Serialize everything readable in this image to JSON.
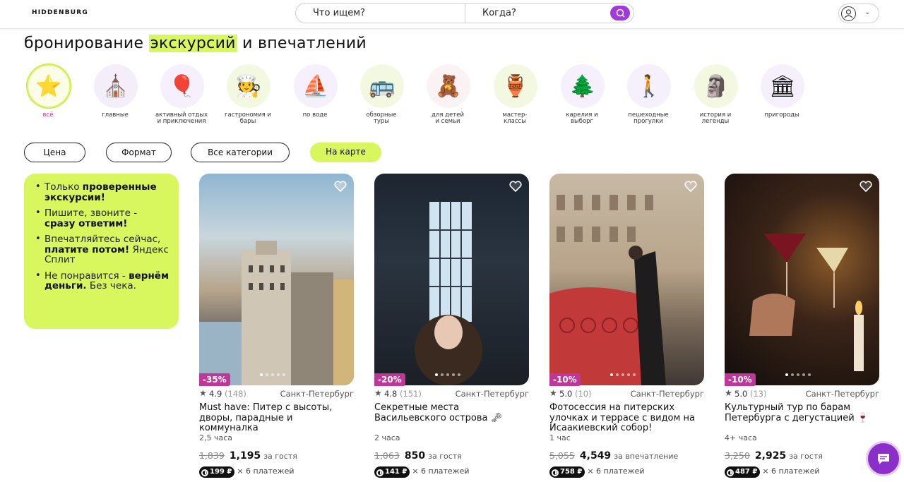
{
  "header": {
    "logo": "HIDDENBURG",
    "search": {
      "what": "Что ищем?",
      "when": "Когда?"
    }
  },
  "title": {
    "prefix": "бронирование ",
    "highlight": "экскурсий",
    "suffix": " и впечатлений"
  },
  "categories": [
    {
      "label": "всё",
      "icon": "star-icon",
      "emoji": "⭐",
      "active": true
    },
    {
      "label": "главные",
      "icon": "cathedral-icon",
      "emoji": "⛪"
    },
    {
      "label": "активный отдых и приключения",
      "icon": "balloon-icon",
      "emoji": "🎈"
    },
    {
      "label": "гастрономия и бары",
      "icon": "chef-icon",
      "emoji": "🧑‍🍳"
    },
    {
      "label": "по воде",
      "icon": "boat-icon",
      "emoji": "⛵"
    },
    {
      "label": "обзорные туры",
      "icon": "bus-icon",
      "emoji": "🚌"
    },
    {
      "label": "для детей и семьи",
      "icon": "teddy-bear-icon",
      "emoji": "🧸"
    },
    {
      "label": "мастер-классы",
      "icon": "potter-icon",
      "emoji": "🏺"
    },
    {
      "label": "карелия и выборг",
      "icon": "forest-icon",
      "emoji": "🌲"
    },
    {
      "label": "пешеходные прогулки",
      "icon": "walkers-icon",
      "emoji": "🚶"
    },
    {
      "label": "история и легенды",
      "icon": "sphinx-icon",
      "emoji": "🗿"
    },
    {
      "label": "пригороды",
      "icon": "column-icon",
      "emoji": "🏛"
    }
  ],
  "filters": {
    "price": "Цена",
    "format": "Формат",
    "all_categories": "Все категории",
    "on_map": "На карте"
  },
  "promo": {
    "item1": {
      "plain": "Только ",
      "bold": "проверенные экскурсии!"
    },
    "item2": {
      "plain": "Пишите, звоните - ",
      "bold": "сразу ответим!"
    },
    "item3": {
      "plain1": "Впечатляйтесь сейчас, ",
      "bold": "платите потом!",
      "plain2": " Яндекс Сплит"
    },
    "item4": {
      "plain1": "Не понравится - ",
      "bold": "вернём деньги.",
      "plain2": " Без чека."
    }
  },
  "cards": [
    {
      "discount": "-35%",
      "rating": "4.9",
      "reviews": "(148)",
      "city": "Санкт-Петербург",
      "title": "Must have: Питер с высоты, дворы, парадные и коммуналка",
      "duration": "2,5 часа",
      "old_price": "1,839",
      "new_price": "1,195",
      "per": "за гостя",
      "split_amount": "199 ₽",
      "split_text": "× 6 платежей"
    },
    {
      "discount": "-20%",
      "rating": "4.8",
      "reviews": "(151)",
      "city": "Санкт-Петербург",
      "title": "Секретные места Васильевского острова 🗝",
      "duration": "2 часа",
      "old_price": "1,063",
      "new_price": "850",
      "per": "за гостя",
      "split_amount": "141 ₽",
      "split_text": "× 6 платежей"
    },
    {
      "discount": "-10%",
      "rating": "5.0",
      "reviews": "(10)",
      "city": "Санкт-Петербург",
      "title": "Фотосессия на питерских улочках и террасе с видом на Исаакиевский собор!",
      "duration": "1 час",
      "old_price": "5,055",
      "new_price": "4,549",
      "per": "за впечатление",
      "split_amount": "758 ₽",
      "split_text": "× 6 платежей"
    },
    {
      "discount": "-10%",
      "rating": "5.0",
      "reviews": "(13)",
      "city": "Санкт-Петербург",
      "title": "Культурный тур по барам Петербурга с дегустацией 🍷",
      "duration": "4+ часа",
      "old_price": "3,250",
      "new_price": "2,925",
      "per": "за гостя",
      "split_amount": "487 ₽",
      "split_text": "× 6 платежей"
    }
  ],
  "colors": {
    "accent_green": "#d8f65e",
    "accent_purple": "#a23ad9",
    "discount_pink": "#c0379a"
  }
}
